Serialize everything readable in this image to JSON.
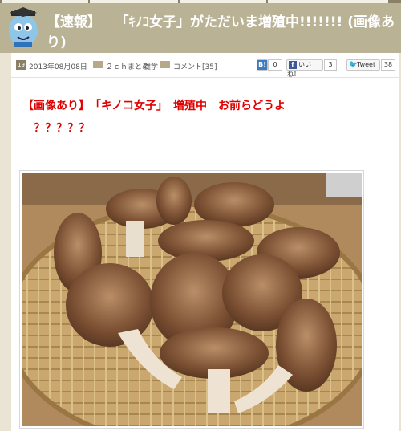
{
  "header": {
    "title_part1": "【速報】",
    "title_part2": "「ｷﾉｺ女子」がただいま増殖中!!!!!!! (画像あり)"
  },
  "meta": {
    "cal_label": "19",
    "date": "2013年08月08日",
    "category1": "２ｃｈまとめ",
    "category2": "雑学",
    "comments": "コメント[35]"
  },
  "social": {
    "hatena_count": "0",
    "fb_like_label": "いいね！",
    "fb_count": "3",
    "tweet_label": "Tweet",
    "tweet_count": "38"
  },
  "article": {
    "headline_line1": "【画像あり】　「キノコ女子」　増殖中　お前らどうよ",
    "headline_line2": "？？？？？"
  },
  "colors": {
    "header_bg": "#b9b295",
    "headline_red": "#e00000",
    "page_bg": "#e9e4d3"
  }
}
